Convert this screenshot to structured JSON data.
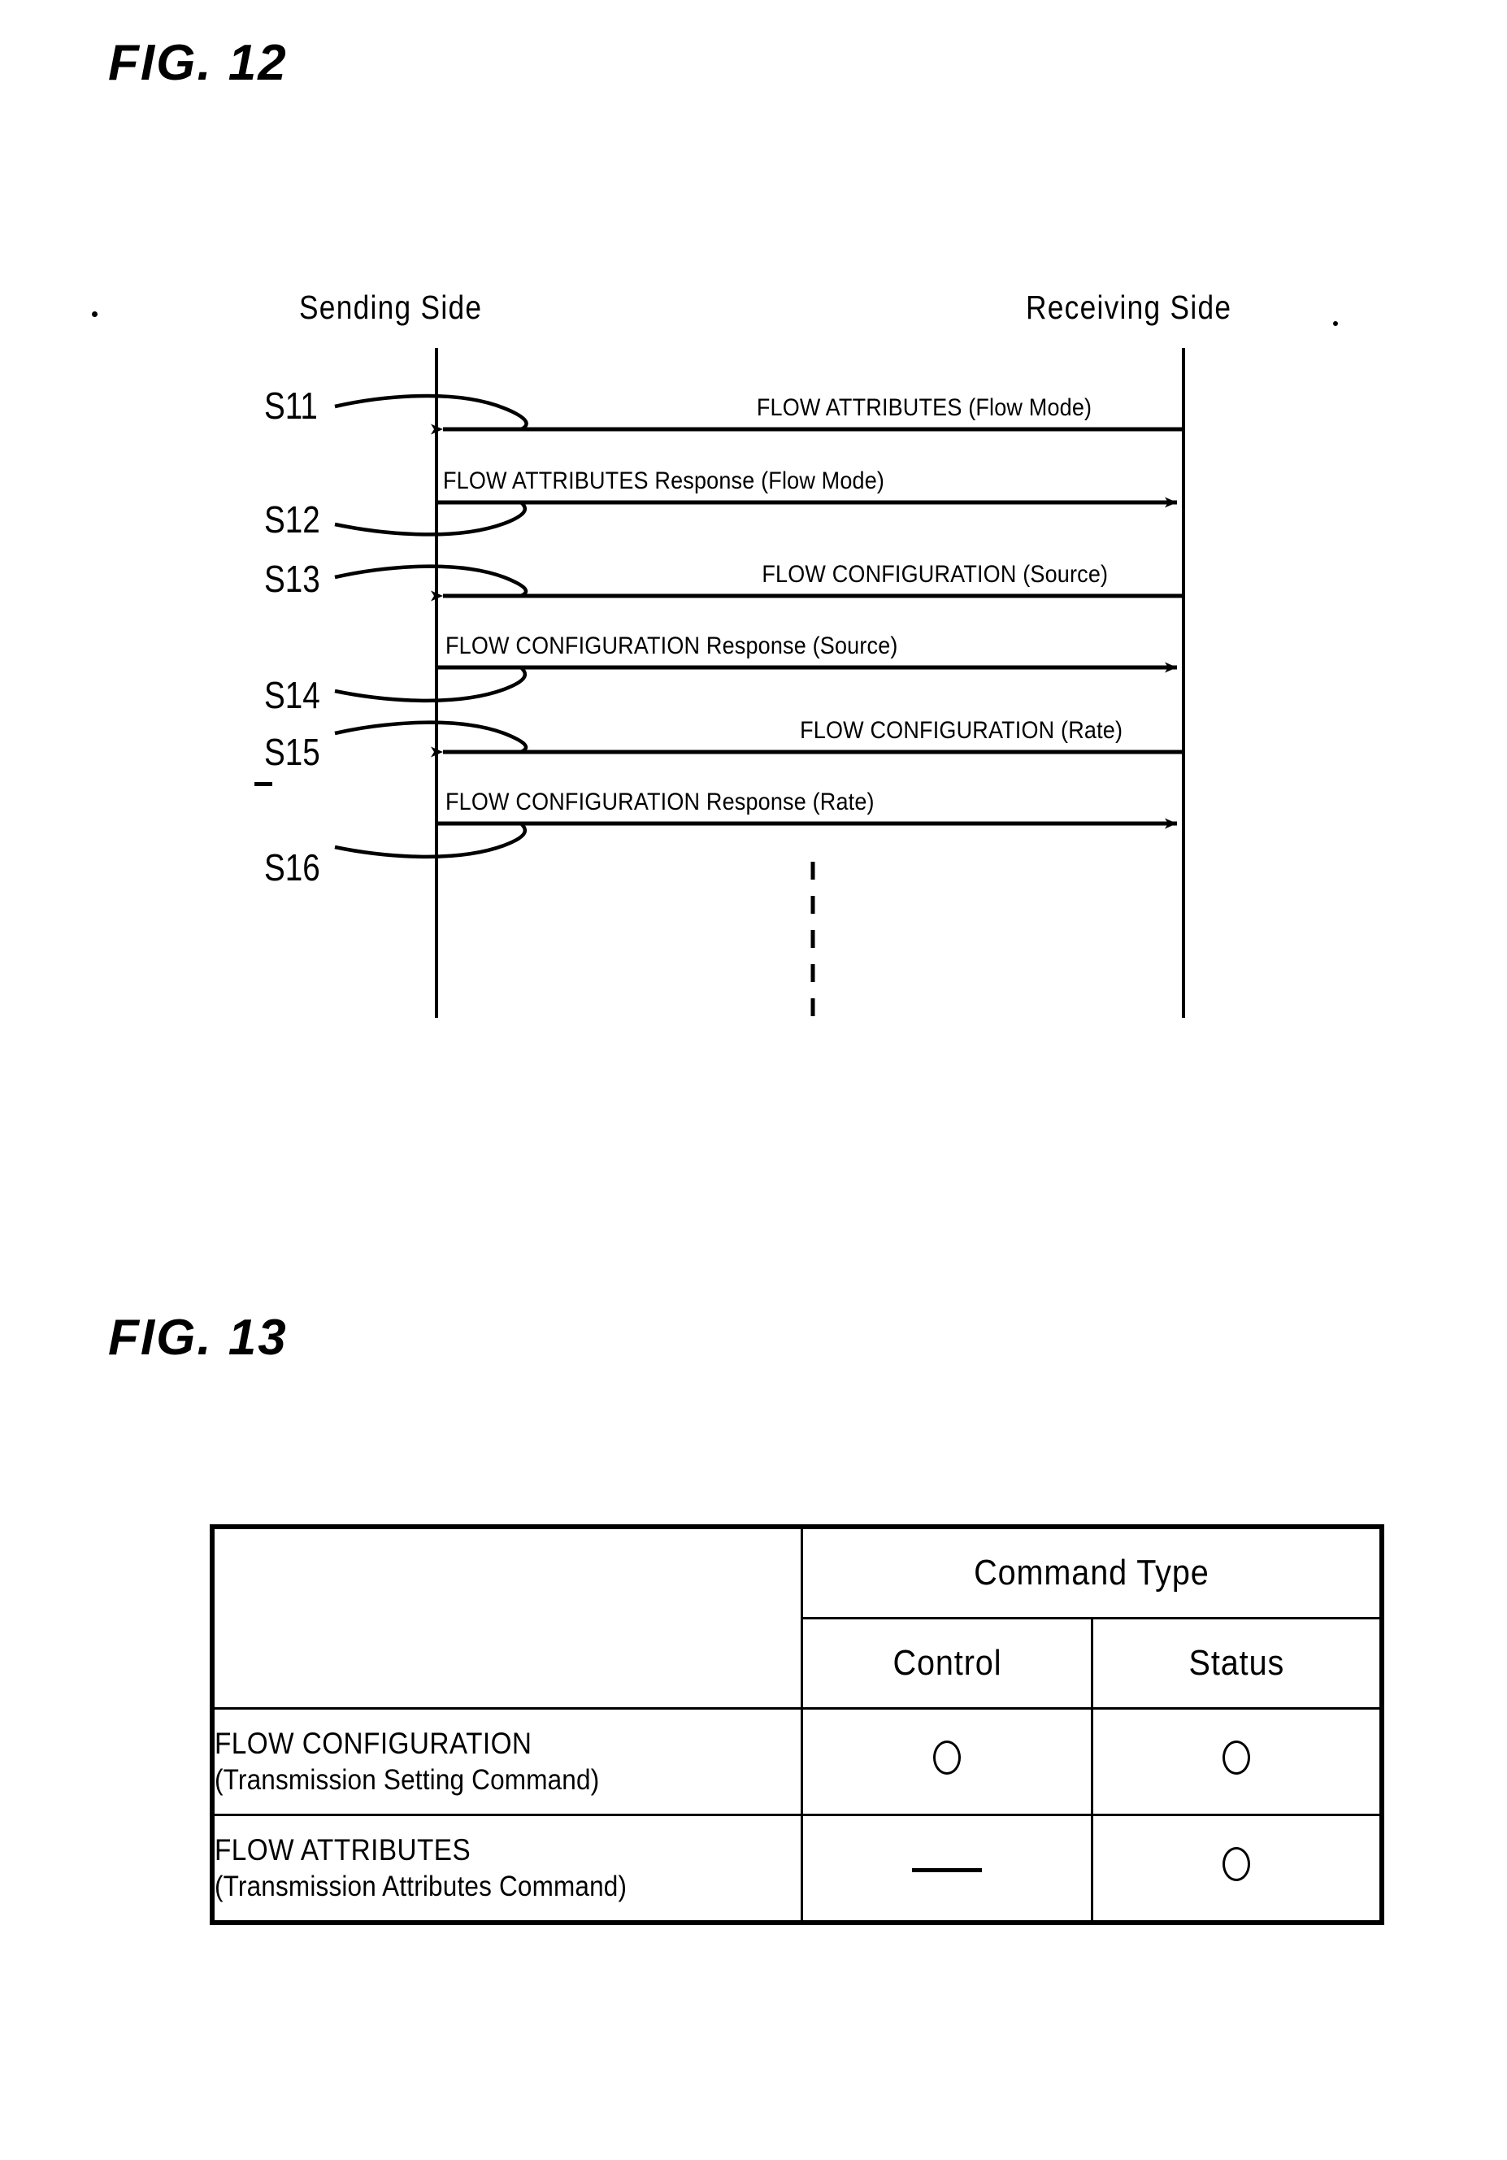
{
  "figures": {
    "fig12": {
      "title": "FIG. 12",
      "lifelines": {
        "left": "Sending Side",
        "right": "Receiving Side"
      },
      "steps": [
        {
          "id": "S11",
          "label": "S11"
        },
        {
          "id": "S12",
          "label": "S12"
        },
        {
          "id": "S13",
          "label": "S13"
        },
        {
          "id": "S14",
          "label": "S14"
        },
        {
          "id": "S15",
          "label": "S15"
        },
        {
          "id": "S16",
          "label": "S16"
        }
      ],
      "messages": [
        {
          "step": "S11",
          "text": "FLOW ATTRIBUTES (Flow Mode)",
          "direction": "right-to-left",
          "align": "right"
        },
        {
          "step": "S12",
          "text": "FLOW ATTRIBUTES Response (Flow Mode)",
          "direction": "left-to-right",
          "align": "left"
        },
        {
          "step": "S13",
          "text": "FLOW CONFIGURATION (Source)",
          "direction": "right-to-left",
          "align": "right"
        },
        {
          "step": "S14",
          "text": "FLOW CONFIGURATION Response (Source)",
          "direction": "left-to-right",
          "align": "left"
        },
        {
          "step": "S15",
          "text": "FLOW CONFIGURATION (Rate)",
          "direction": "right-to-left",
          "align": "right"
        },
        {
          "step": "S16",
          "text": "FLOW CONFIGURATION Response (Rate)",
          "direction": "left-to-right",
          "align": "left"
        }
      ],
      "continuation": "vertical-dashed-line"
    },
    "fig13": {
      "title": "FIG. 13",
      "table": {
        "group_header": "Command Type",
        "columns": [
          "Control",
          "Status"
        ],
        "rows": [
          {
            "name": "FLOW CONFIGURATION",
            "subtitle": "(Transmission Setting Command)",
            "control": "circle",
            "status": "circle"
          },
          {
            "name": "FLOW ATTRIBUTES",
            "subtitle": "(Transmission Attributes Command)",
            "control": "dash",
            "status": "circle"
          }
        ]
      }
    }
  },
  "colors": {
    "ink": "#000000",
    "paper": "#ffffff"
  }
}
